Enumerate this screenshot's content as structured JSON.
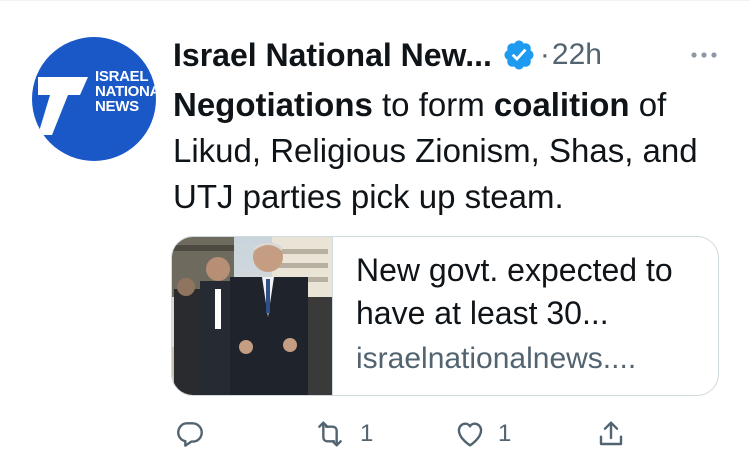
{
  "tweet": {
    "author": {
      "name": "Israel National New...",
      "avatar_text": [
        "ISRAEL",
        "NATIONAL",
        "NEWS"
      ],
      "verified": true
    },
    "separator": "·",
    "time": "22h",
    "text": {
      "word_1": "Negotiations",
      "part_2": " to form ",
      "word_3": "coalition",
      "part_4": " of Likud, Religious Zionism, Shas, and UTJ parties pick up steam."
    },
    "card": {
      "title": "New govt. expected to have at least 30...",
      "domain": "israelnationalnews...."
    },
    "actions": {
      "reply_count": "",
      "retweet_count": "1",
      "like_count": "1"
    }
  },
  "colors": {
    "brand_blue": "#1a58c8",
    "verified_blue": "#1d9bf0",
    "secondary_text": "#536471",
    "border": "#cfd9de"
  },
  "icons": [
    "verified-icon",
    "more-icon",
    "reply-icon",
    "retweet-icon",
    "like-icon",
    "share-icon"
  ]
}
